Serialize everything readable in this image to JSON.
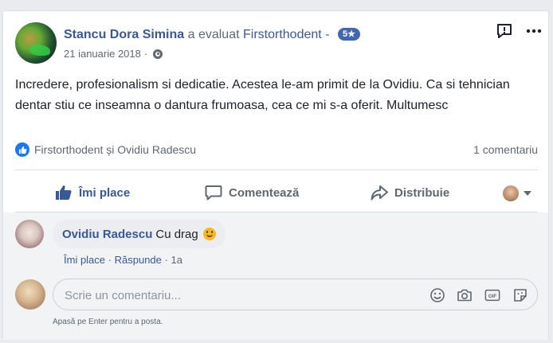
{
  "post": {
    "author": "Stancu Dora Simina",
    "rated_text": "a evaluat",
    "page": "Firstorthodent",
    "separator": "-",
    "rating": "5★",
    "date": "21 ianuarie 2018",
    "dot": "·",
    "text": "Incredere, profesionalism si dedicatie. Acestea le-am primit de la Ovidiu. Ca si tehnician dentar stiu ce inseamna o dantura frumoasa, cea ce mi s-a oferit. Multumesc"
  },
  "reactions": {
    "people": "Firstorthodent și Ovidiu Radescu",
    "comments_count": "1 comentariu"
  },
  "actions": {
    "like": "Îmi place",
    "comment": "Comentează",
    "share": "Distribuie"
  },
  "comment": {
    "author": "Ovidiu Radescu",
    "text": "Cu drag",
    "like": "Îmi place",
    "reply": "Răspunde",
    "sep": "·",
    "age": "1a"
  },
  "composer": {
    "placeholder": "Scrie un comentariu...",
    "hint": "Apasă pe Enter pentru a posta.",
    "gif_label": "GIF"
  },
  "colors": {
    "link": "#385898",
    "accent": "#4267b2",
    "like_blue": "#1877f2",
    "muted": "#616770"
  }
}
